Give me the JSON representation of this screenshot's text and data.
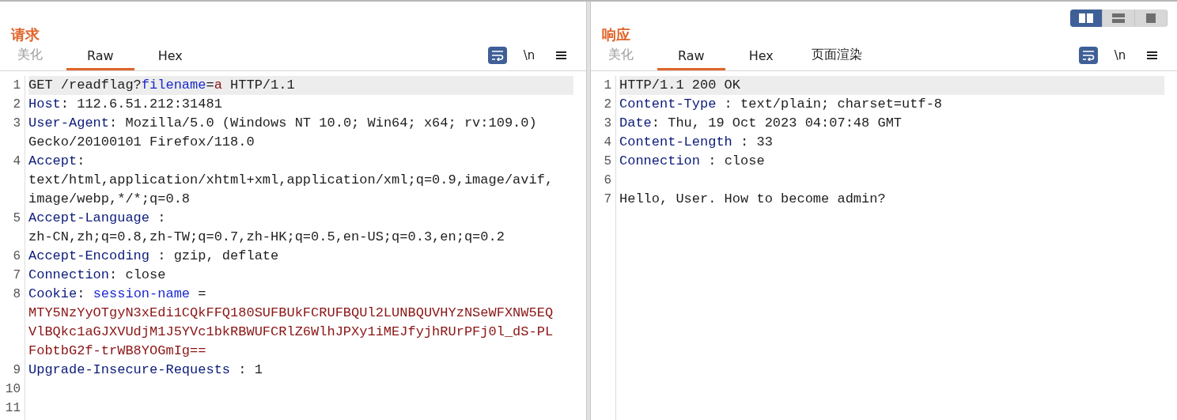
{
  "layout_toggle": [
    {
      "kind": "split-columns",
      "selected": true
    },
    {
      "kind": "split-rows",
      "selected": false
    },
    {
      "kind": "single",
      "selected": false
    }
  ],
  "panes": [
    {
      "title": "请求",
      "tabs": [
        {
          "label": "美化",
          "selected": false,
          "disabled": true
        },
        {
          "label": "Raw",
          "selected": true,
          "disabled": false
        },
        {
          "label": "Hex",
          "selected": false,
          "disabled": false
        }
      ],
      "wrap_on": true,
      "newline_label": "\\n",
      "lines": [
        {
          "number": "1",
          "highlighted": true,
          "rows": [
            [
              {
                "kind": "plain",
                "text": "GET /readflag?"
              },
              {
                "kind": "param",
                "text": "filename"
              },
              {
                "kind": "plain",
                "text": "="
              },
              {
                "kind": "value",
                "text": "a"
              },
              {
                "kind": "plain",
                "text": " HTTP/1.1"
              }
            ]
          ]
        },
        {
          "number": "2",
          "highlighted": false,
          "rows": [
            [
              {
                "kind": "key",
                "text": "Host"
              },
              {
                "kind": "plain",
                "text": ": 112.6.51.212:31481"
              }
            ]
          ]
        },
        {
          "number": "3",
          "highlighted": false,
          "rows": [
            [
              {
                "kind": "key",
                "text": "User-Agent"
              },
              {
                "kind": "plain",
                "text": ": Mozilla/5.0 (Windows NT 10.0; Win64; x64; rv:109.0)"
              }
            ],
            [
              {
                "kind": "plain",
                "text": "Gecko/20100101 Firefox/118.0"
              }
            ]
          ]
        },
        {
          "number": "4",
          "highlighted": false,
          "rows": [
            [
              {
                "kind": "key",
                "text": "Accept"
              },
              {
                "kind": "plain",
                "text": ":"
              }
            ],
            [
              {
                "kind": "plain",
                "text": "text/html,application/xhtml+xml,application/xml;q=0.9,image/avif,"
              }
            ],
            [
              {
                "kind": "plain",
                "text": "image/webp,*/*;q=0.8"
              }
            ]
          ]
        },
        {
          "number": "5",
          "highlighted": false,
          "rows": [
            [
              {
                "kind": "key",
                "text": "Accept-Language"
              },
              {
                "kind": "plain",
                "text": " :"
              }
            ],
            [
              {
                "kind": "plain",
                "text": "zh-CN,zh;q=0.8,zh-TW;q=0.7,zh-HK;q=0.5,en-US;q=0.3,en;q=0.2"
              }
            ]
          ]
        },
        {
          "number": "6",
          "highlighted": false,
          "rows": [
            [
              {
                "kind": "key",
                "text": "Accept-Encoding"
              },
              {
                "kind": "plain",
                "text": " : gzip, deflate"
              }
            ]
          ]
        },
        {
          "number": "7",
          "highlighted": false,
          "rows": [
            [
              {
                "kind": "key",
                "text": "Connection"
              },
              {
                "kind": "plain",
                "text": ": close"
              }
            ]
          ]
        },
        {
          "number": "8",
          "highlighted": false,
          "rows": [
            [
              {
                "kind": "key",
                "text": "Cookie"
              },
              {
                "kind": "plain",
                "text": ": "
              },
              {
                "kind": "param",
                "text": "session-name"
              },
              {
                "kind": "plain",
                "text": " ="
              }
            ],
            [
              {
                "kind": "value",
                "text": "MTY5NzYyOTgyN3xEdi1CQkFFQ180SUFBUkFCRUFBQUl2LUNBQUVHYzNSeWFXNW5EQ"
              }
            ],
            [
              {
                "kind": "value",
                "text": "VlBQkc1aGJXVUdjM1J5YVc1bkRBWUFCRlZ6WlhJPXy1iMEJfyjhRUrPFj0l_dS-PL"
              }
            ],
            [
              {
                "kind": "value",
                "text": "FobtbG2f-trWB8YOGmIg=="
              }
            ]
          ]
        },
        {
          "number": "9",
          "highlighted": false,
          "rows": [
            [
              {
                "kind": "key",
                "text": "Upgrade-Insecure-Requests"
              },
              {
                "kind": "plain",
                "text": " : 1"
              }
            ]
          ]
        },
        {
          "number": "10",
          "highlighted": false,
          "rows": [
            []
          ]
        },
        {
          "number": "11",
          "highlighted": false,
          "rows": [
            []
          ]
        }
      ]
    },
    {
      "title": "响应",
      "tabs": [
        {
          "label": "美化",
          "selected": false,
          "disabled": true
        },
        {
          "label": "Raw",
          "selected": true,
          "disabled": false
        },
        {
          "label": "Hex",
          "selected": false,
          "disabled": false
        },
        {
          "label": "页面渲染",
          "selected": false,
          "disabled": false
        }
      ],
      "wrap_on": true,
      "newline_label": "\\n",
      "lines": [
        {
          "number": "1",
          "highlighted": true,
          "rows": [
            [
              {
                "kind": "plain",
                "text": "HTTP/1.1 200 OK"
              }
            ]
          ]
        },
        {
          "number": "2",
          "highlighted": false,
          "rows": [
            [
              {
                "kind": "key",
                "text": "Content-Type"
              },
              {
                "kind": "plain",
                "text": " : text/plain; charset=utf-8"
              }
            ]
          ]
        },
        {
          "number": "3",
          "highlighted": false,
          "rows": [
            [
              {
                "kind": "key",
                "text": "Date"
              },
              {
                "kind": "plain",
                "text": ": Thu, 19 Oct 2023 04:07:48 GMT"
              }
            ]
          ]
        },
        {
          "number": "4",
          "highlighted": false,
          "rows": [
            [
              {
                "kind": "key",
                "text": "Content-Length"
              },
              {
                "kind": "plain",
                "text": " : 33"
              }
            ]
          ]
        },
        {
          "number": "5",
          "highlighted": false,
          "rows": [
            [
              {
                "kind": "key",
                "text": "Connection"
              },
              {
                "kind": "plain",
                "text": " : close"
              }
            ]
          ]
        },
        {
          "number": "6",
          "highlighted": false,
          "rows": [
            []
          ]
        },
        {
          "number": "7",
          "highlighted": false,
          "rows": [
            [
              {
                "kind": "plain",
                "text": "Hello, User. How to become admin?"
              }
            ]
          ]
        }
      ]
    }
  ]
}
